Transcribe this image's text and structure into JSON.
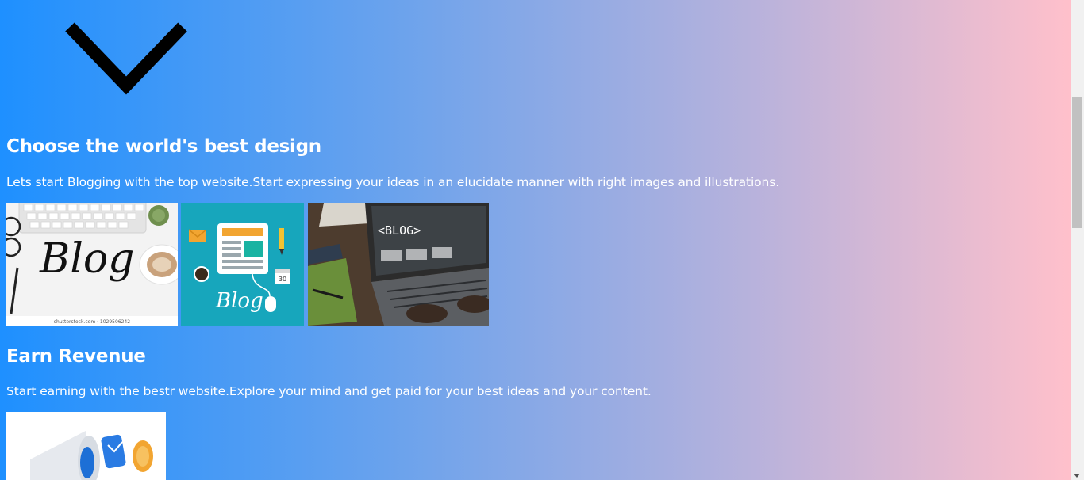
{
  "sections": [
    {
      "title": "Choose the world's best design",
      "text": "Lets start Blogging with the top website.Start expressing your ideas in an elucidate manner with right images and illustrations."
    },
    {
      "title": "Earn Revenue",
      "text": "Start earning with the bestr website.Explore your mind and get paid for your best ideas and your content."
    }
  ],
  "images": {
    "blog_script": {
      "word": "Blog",
      "credit": "shutterstock.com · 1029506242"
    },
    "blog_illustration": {
      "word": "Blog",
      "calendar": "30"
    },
    "blog_laptop": {
      "screen_text": "<BLOG>"
    }
  },
  "icons": {
    "scroll_down": "chevron-down-icon"
  },
  "colors": {
    "gradient_start": "#1e90ff",
    "gradient_end": "#ffc0cb",
    "illustration_bg": "#17a6bc"
  }
}
